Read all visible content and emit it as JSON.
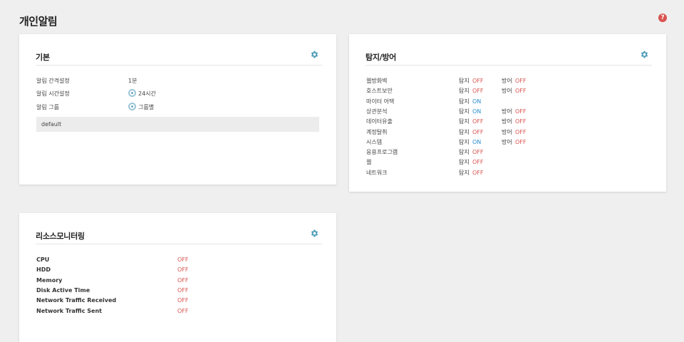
{
  "page": {
    "title": "개인알림",
    "help_icon": "?"
  },
  "basic": {
    "title": "기본",
    "rows": [
      {
        "label": "알림 간격설정",
        "value": "1분"
      },
      {
        "label": "알림 시간설정",
        "value": "24시간"
      },
      {
        "label": "알림 그룹",
        "value": "그룹별"
      }
    ],
    "group_default": "default"
  },
  "detect": {
    "title": "탐지/방어",
    "detect_label": "탐지",
    "defend_label": "방어",
    "rows": [
      {
        "name": "웹방화벽",
        "detect": "OFF",
        "defend": "OFF"
      },
      {
        "name": "호스트보안",
        "detect": "OFF",
        "defend": "OFF"
      },
      {
        "name": "마이터 어택",
        "detect": "ON",
        "defend": null
      },
      {
        "name": "상관분석",
        "detect": "ON",
        "defend": "OFF"
      },
      {
        "name": "데이터유출",
        "detect": "OFF",
        "defend": "OFF"
      },
      {
        "name": "계정탈취",
        "detect": "OFF",
        "defend": "OFF"
      },
      {
        "name": "시스템",
        "detect": "ON",
        "defend": "OFF"
      },
      {
        "name": "응용프로그램",
        "detect": "OFF",
        "defend": null
      },
      {
        "name": "웹",
        "detect": "OFF",
        "defend": null
      },
      {
        "name": "네트워크",
        "detect": "OFF",
        "defend": null
      }
    ]
  },
  "resource": {
    "title": "리소스모니터링",
    "rows": [
      {
        "name": "CPU",
        "status": "OFF"
      },
      {
        "name": "HDD",
        "status": "OFF"
      },
      {
        "name": "Memory",
        "status": "OFF"
      },
      {
        "name": "Disk Active Time",
        "status": "OFF"
      },
      {
        "name": "Network Traffic Received",
        "status": "OFF"
      },
      {
        "name": "Network Traffic Sent",
        "status": "OFF"
      }
    ]
  },
  "colors": {
    "off": "#d9534f",
    "on": "#2a8ed3",
    "gear": "#4a9bb5"
  },
  "icons": {
    "gear": "gear-icon",
    "help": "help-icon",
    "radio": "radio-selected-icon"
  }
}
